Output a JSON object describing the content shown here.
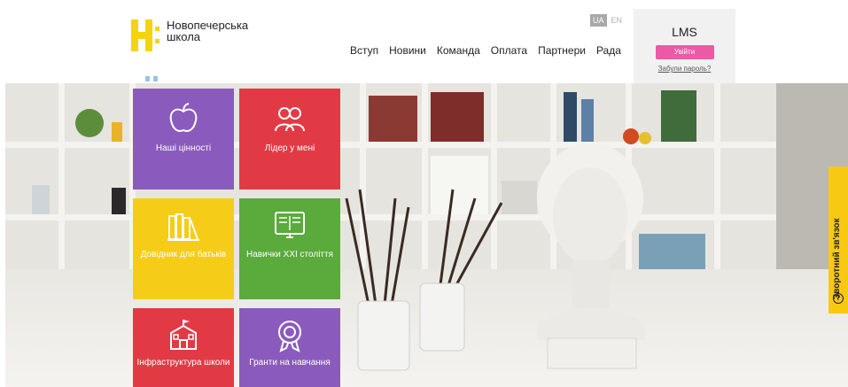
{
  "logo": {
    "line1": "Новопечерська",
    "line2": "школа"
  },
  "nav": {
    "items": [
      "Вступ",
      "Новини",
      "Команда",
      "Оплата",
      "Партнери",
      "Рада"
    ]
  },
  "lang": {
    "ua": "UA",
    "en": "EN"
  },
  "lms": {
    "title": "LMS",
    "login": "Увійти",
    "forgot": "Забули пароль?"
  },
  "tiles": [
    {
      "label": "Наші цінності",
      "color": "#8a5bbd",
      "icon": "apple-icon"
    },
    {
      "label": "Лідер у мені",
      "color": "#e23a44",
      "icon": "people-icon"
    },
    {
      "label": "Довідник для батьків",
      "color": "#f5cd18",
      "icon": "books-icon"
    },
    {
      "label": "Навички XXI століття",
      "color": "#5aaa3c",
      "icon": "monitor-book-icon"
    },
    {
      "label": "Інфраструктура школи",
      "color": "#e23a44",
      "icon": "school-building-icon"
    },
    {
      "label": "Гранти на навчання",
      "color": "#8a5bbd",
      "icon": "award-icon"
    }
  ],
  "feedback": {
    "label": "Зворотний зв'язок",
    "icon": "question-icon"
  }
}
